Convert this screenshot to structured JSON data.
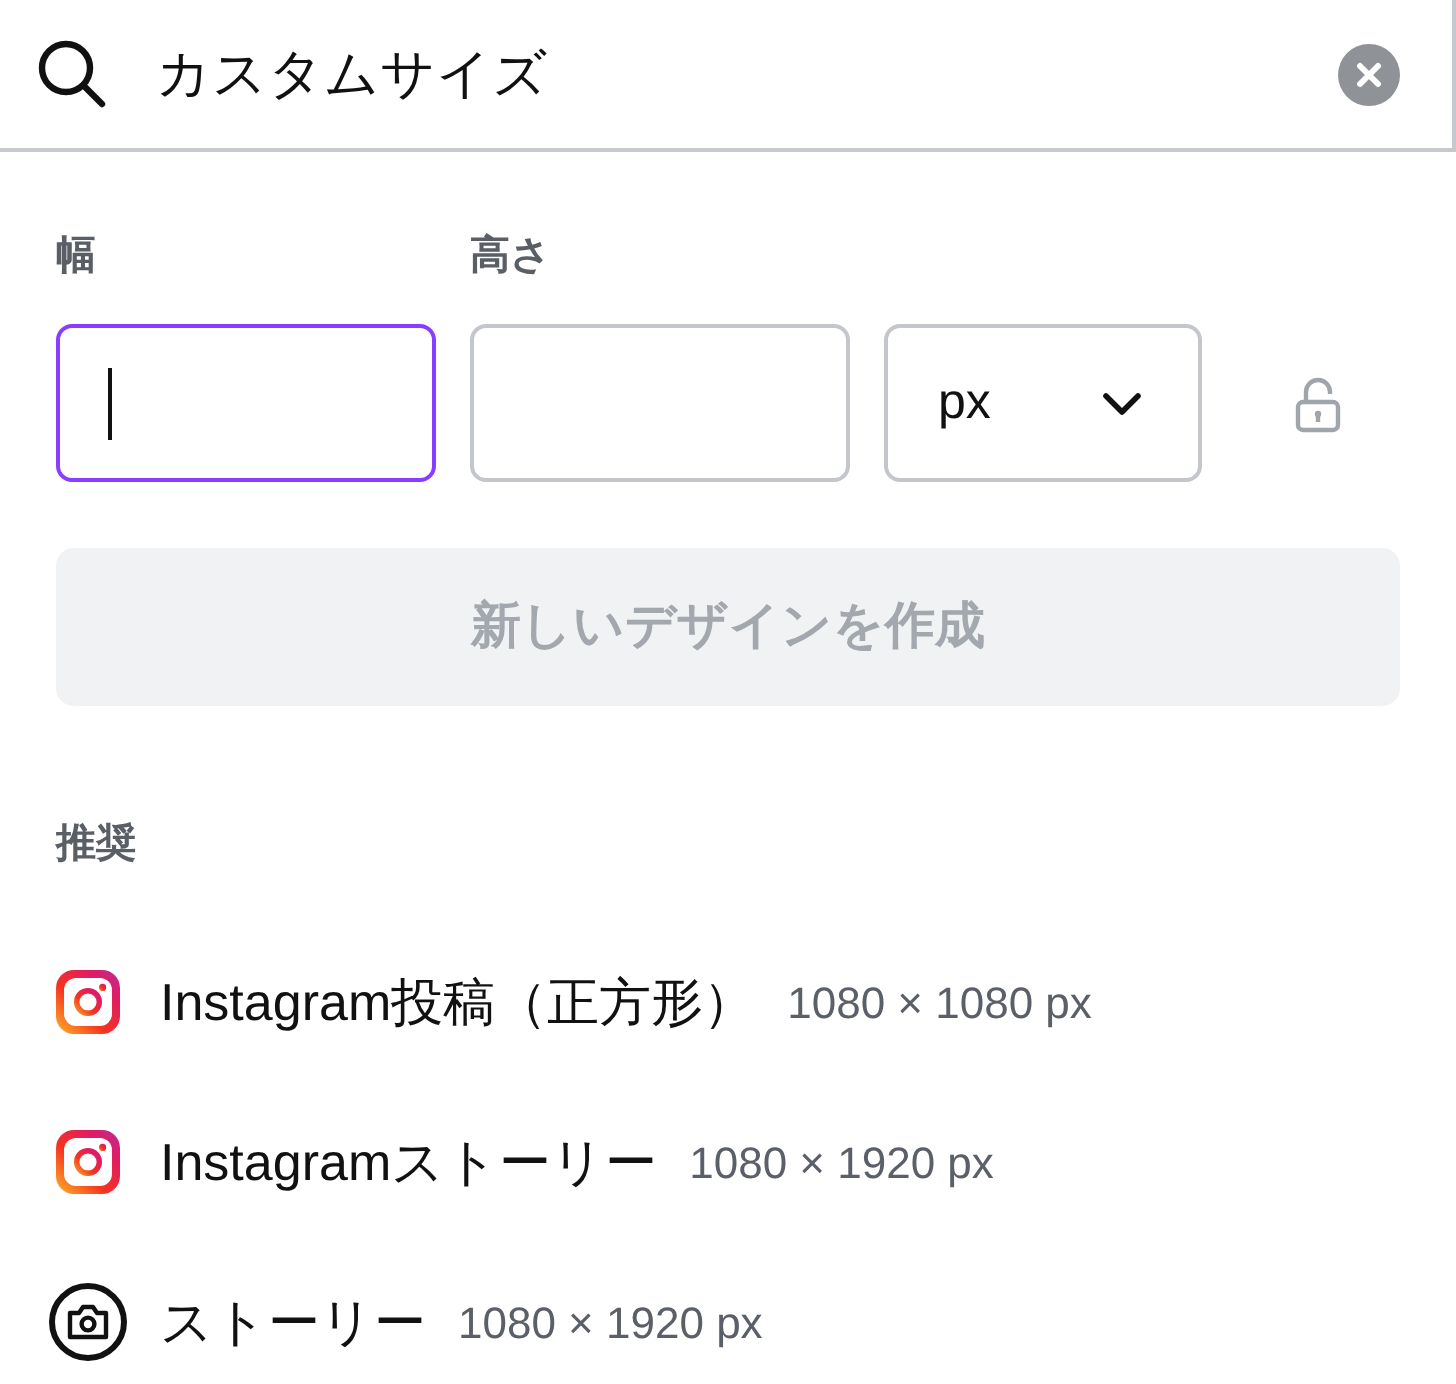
{
  "search": {
    "value": "カスタムサイズ"
  },
  "dimensions": {
    "fields": [
      {
        "label": "幅",
        "focused": true
      },
      {
        "label": "高さ",
        "focused": false
      }
    ],
    "unit": {
      "value": "px"
    },
    "locked": false
  },
  "create_button": {
    "label": "新しいデザインを作成",
    "disabled": true
  },
  "recommended": {
    "heading": "推奨",
    "items": [
      {
        "kind": "instagram",
        "name": "Instagram投稿（正方形）",
        "size": "1080 × 1080 px"
      },
      {
        "kind": "instagram",
        "name": "Instagramストーリー",
        "size": "1080 × 1920 px"
      },
      {
        "kind": "camera",
        "name": "ストーリー",
        "size": "1080 × 1920 px"
      }
    ]
  }
}
